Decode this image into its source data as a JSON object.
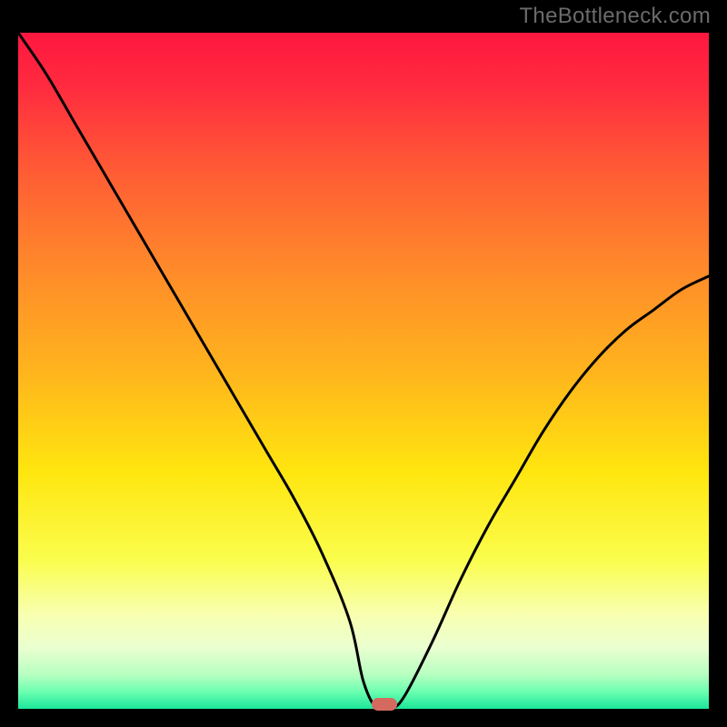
{
  "watermark": "TheBottleneck.com",
  "colors": {
    "gradient_stops": [
      {
        "pct": 0.0,
        "hex": "#ff173f"
      },
      {
        "pct": 0.08,
        "hex": "#ff2b3f"
      },
      {
        "pct": 0.2,
        "hex": "#ff5a35"
      },
      {
        "pct": 0.35,
        "hex": "#ff8a2a"
      },
      {
        "pct": 0.5,
        "hex": "#ffb41d"
      },
      {
        "pct": 0.65,
        "hex": "#ffe60f"
      },
      {
        "pct": 0.78,
        "hex": "#fafd4d"
      },
      {
        "pct": 0.86,
        "hex": "#f8ffb0"
      },
      {
        "pct": 0.91,
        "hex": "#eaffd0"
      },
      {
        "pct": 0.95,
        "hex": "#b6ffc0"
      },
      {
        "pct": 0.975,
        "hex": "#6affb0"
      },
      {
        "pct": 1.0,
        "hex": "#1be69a"
      }
    ],
    "curve": "#000000",
    "marker": "#d46a5f",
    "background": "#000000"
  },
  "chart_data": {
    "type": "line",
    "title": "",
    "xlabel": "",
    "ylabel": "",
    "xlim": [
      0,
      100
    ],
    "ylim": [
      0,
      100
    ],
    "x": [
      0,
      4,
      8,
      12,
      16,
      20,
      24,
      28,
      32,
      36,
      40,
      44,
      48,
      50,
      52,
      54,
      56,
      60,
      64,
      68,
      72,
      76,
      80,
      84,
      88,
      92,
      96,
      100
    ],
    "values": [
      100,
      94,
      87,
      80,
      73,
      66,
      59,
      52,
      45,
      38,
      31,
      23,
      13,
      4,
      0,
      0,
      2,
      10,
      19,
      27,
      34,
      41,
      47,
      52,
      56,
      59,
      62,
      64
    ],
    "marker": {
      "x": 53,
      "y": 0
    },
    "legend": [],
    "grid": false
  }
}
